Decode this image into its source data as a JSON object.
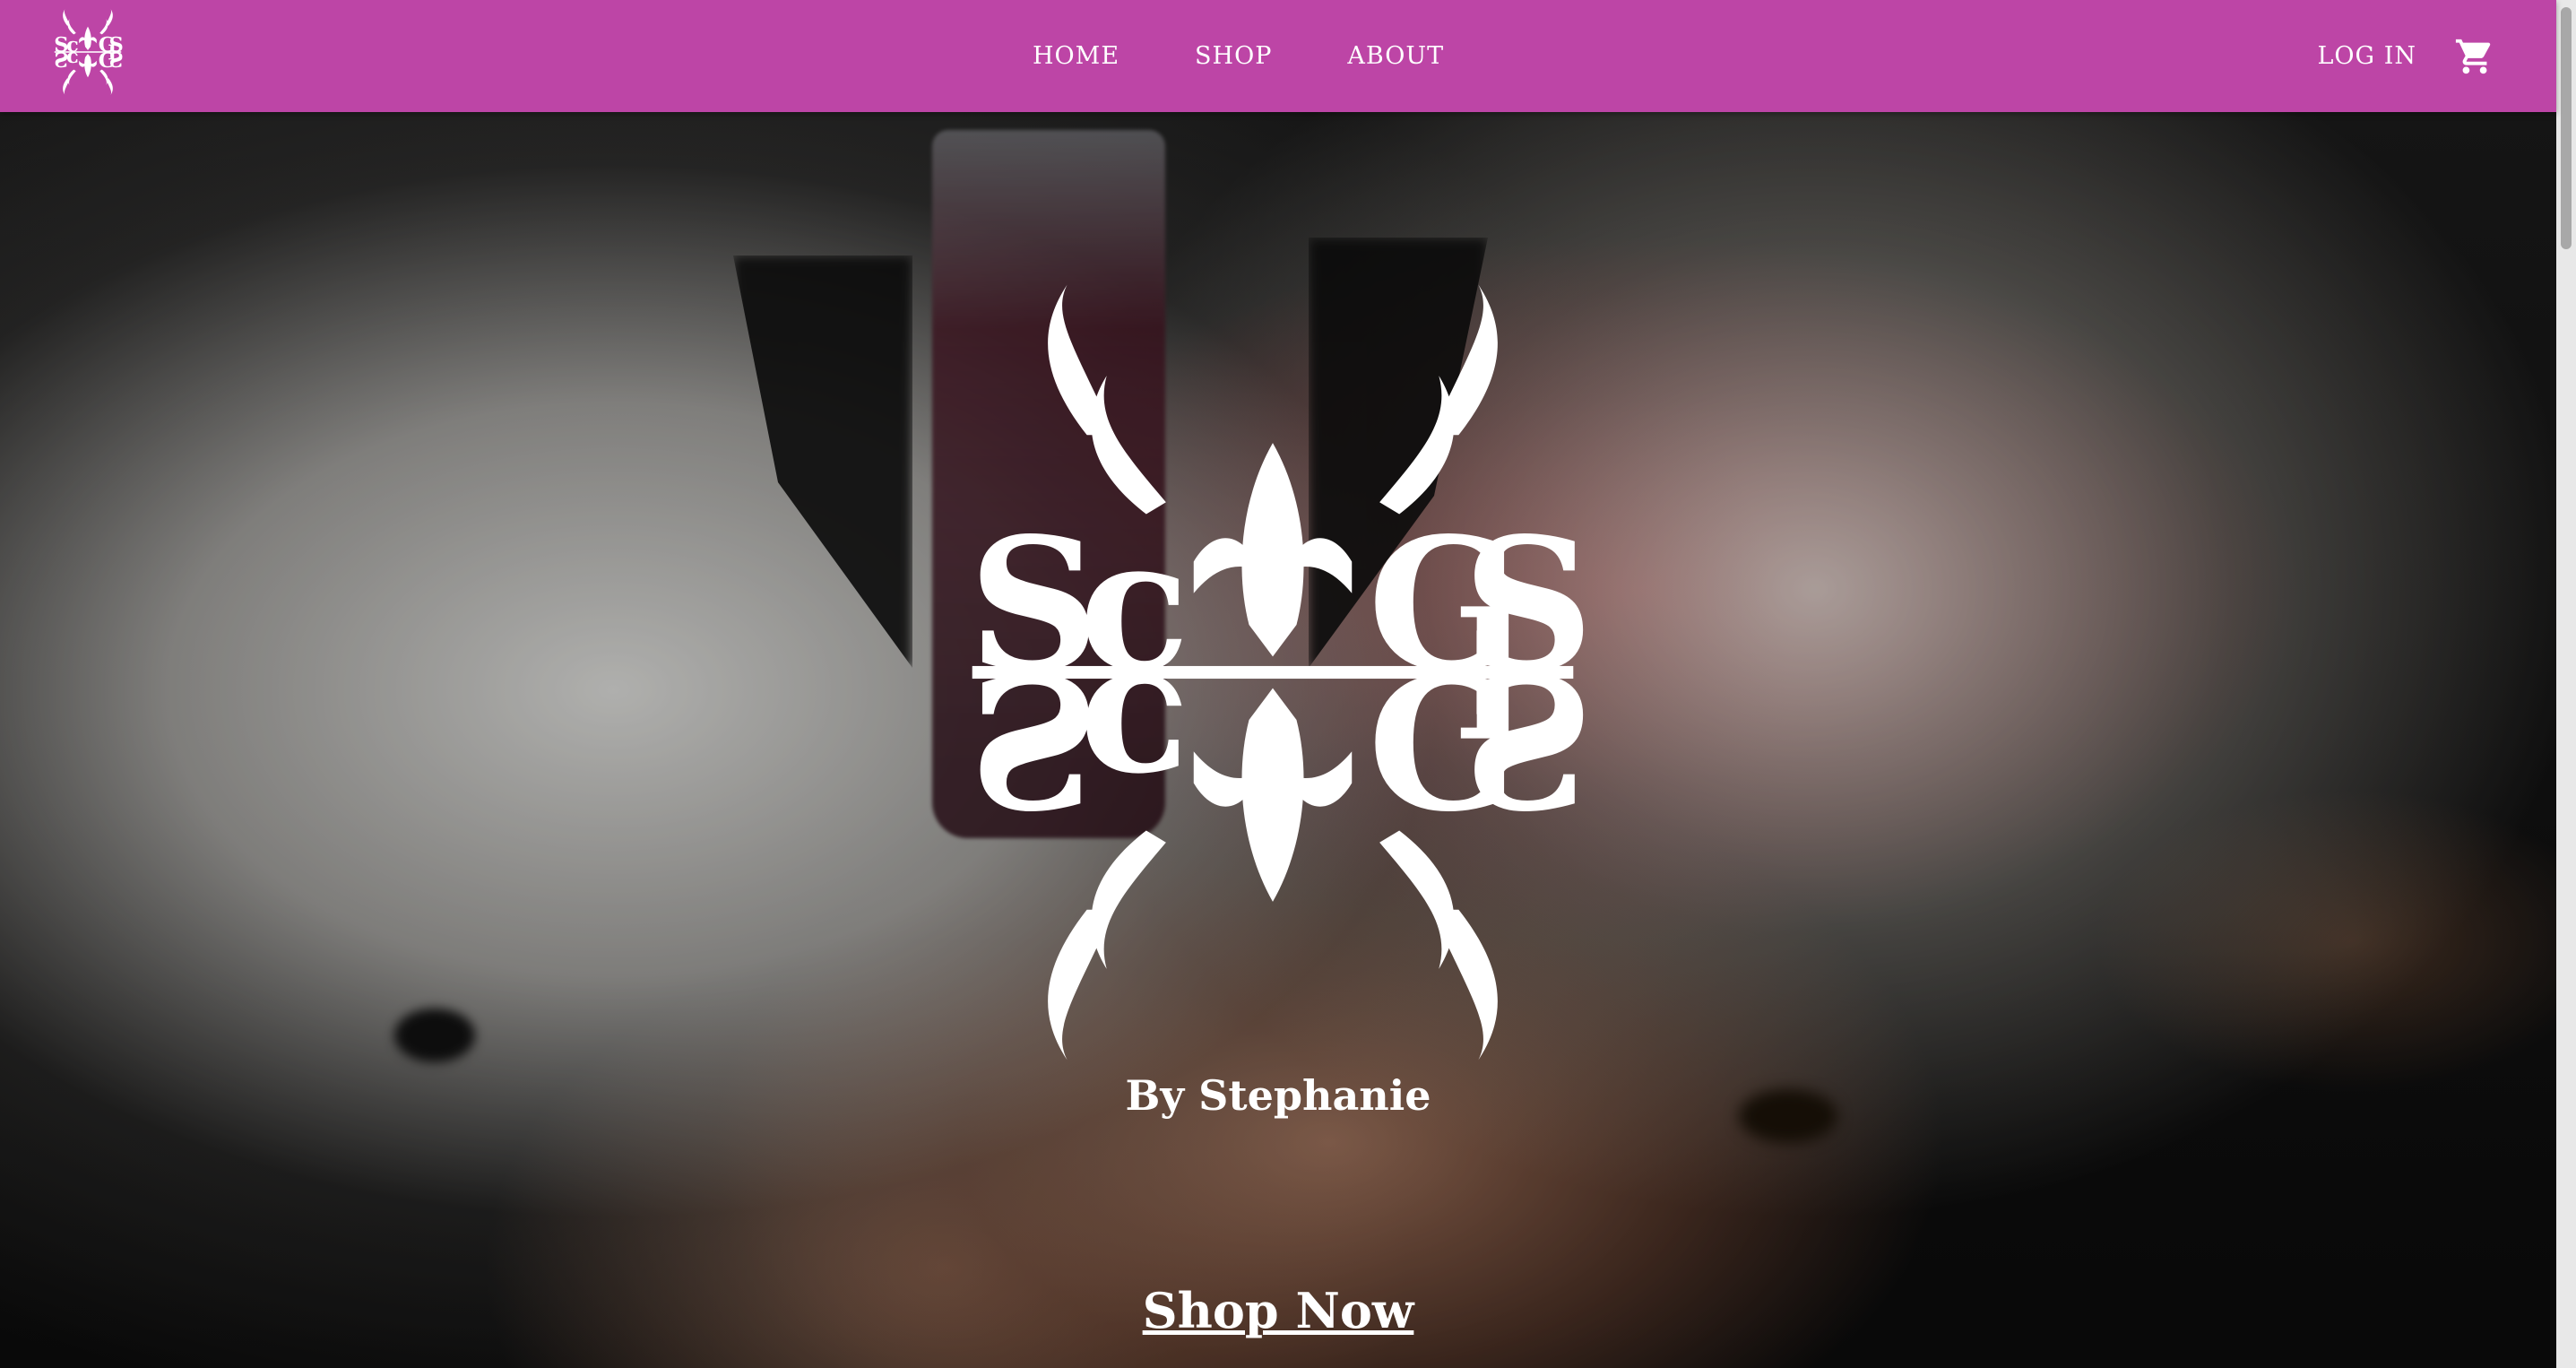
{
  "nav": {
    "links": [
      "HOME",
      "SHOP",
      "ABOUT"
    ],
    "login_label": "LOG IN",
    "logo_icon": "scgs-monogram-logo",
    "cart_icon": "shopping-cart-icon"
  },
  "hero": {
    "tagline": "By Stephanie",
    "cta_label": "Shop Now",
    "logo_icon": "scgs-monogram-logo"
  },
  "colors": {
    "nav_background": "#bd45a6",
    "text": "#ffffff"
  }
}
